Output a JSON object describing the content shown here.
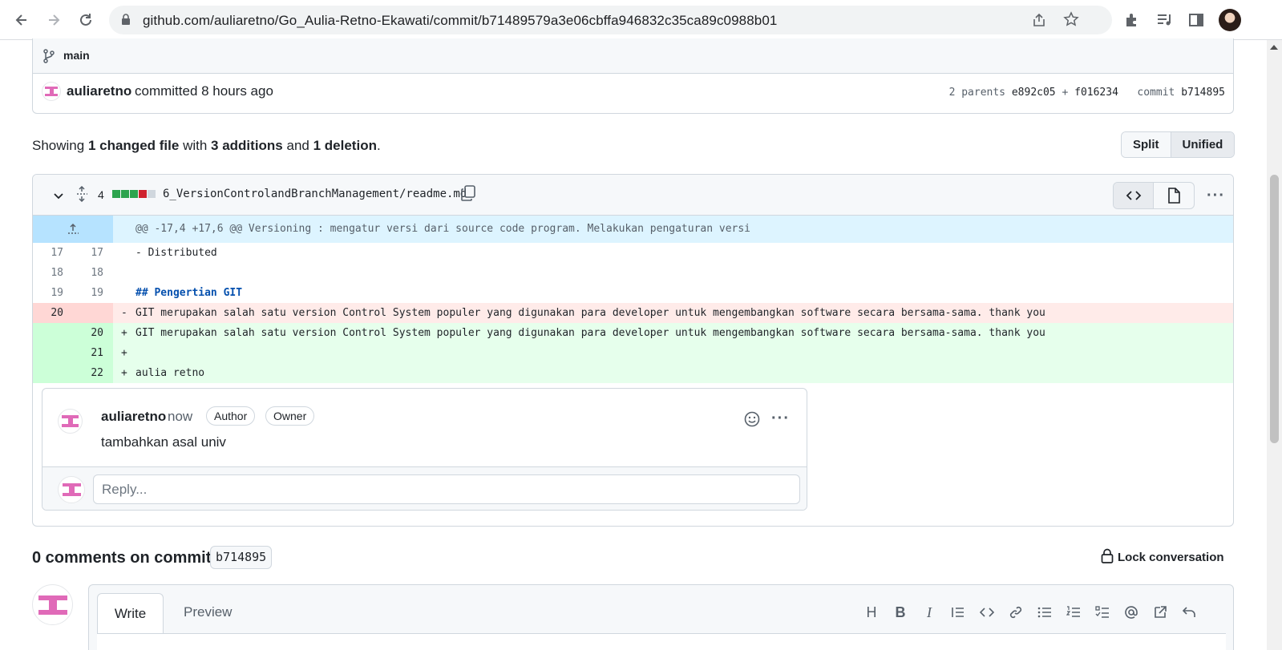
{
  "browser": {
    "url": "github.com/auliaretno/Go_Aulia-Retno-Ekawati/commit/b71489579a3e06cbffa946832c35ca89c0988b01"
  },
  "commit": {
    "branch": "main",
    "author": "auliaretno",
    "committed_text": "committed 8 hours ago",
    "parents_label": "2 parents",
    "parent1": "e892c05",
    "plus": "+",
    "parent2": "f016234",
    "commit_label": "commit",
    "commit_sha": "b714895"
  },
  "summary": {
    "showing": "Showing",
    "changed": "1 changed file",
    "with": "with",
    "additions": "3 additions",
    "and": "and",
    "deletions": "1 deletion",
    "period": ".",
    "split_label": "Split",
    "unified_label": "Unified"
  },
  "file": {
    "change_count": "4",
    "path": "6_VersionControlandBranchManagement/readme.md",
    "diffstat_colors": [
      "#2da44e",
      "#2da44e",
      "#2da44e",
      "#cf222e",
      "#d0d7de"
    ],
    "hunk_header": "@@ -17,4 +17,6 @@ Versioning : mengatur versi dari source code program. Melakukan pengaturan versi",
    "lines": [
      {
        "old": "17",
        "new": "17",
        "sign": "",
        "text": "- Distributed",
        "type": "ctx"
      },
      {
        "old": "18",
        "new": "18",
        "sign": "",
        "text": "",
        "type": "ctx"
      },
      {
        "old": "19",
        "new": "19",
        "sign": "",
        "text": "## Pengertian GIT",
        "type": "ctx"
      },
      {
        "old": "20",
        "new": "",
        "sign": "-",
        "text": "GIT merupakan salah satu version Control System populer yang digunakan para developer untuk mengembangkan software secara bersama-sama. thank you",
        "type": "del"
      },
      {
        "old": "",
        "new": "20",
        "sign": "+",
        "text": "GIT merupakan salah satu version Control System populer yang digunakan para developer untuk mengembangkan software secara bersama-sama. thank you",
        "type": "add"
      },
      {
        "old": "",
        "new": "21",
        "sign": "+",
        "text": "",
        "type": "add"
      },
      {
        "old": "",
        "new": "22",
        "sign": "+",
        "text": "aulia retno",
        "type": "add"
      }
    ]
  },
  "inline_comment": {
    "author": "auliaretno",
    "time": "now",
    "badge_author": "Author",
    "badge_owner": "Owner",
    "body": "tambahkan asal univ",
    "reply_placeholder": "Reply..."
  },
  "comments": {
    "title": "0 comments on commit",
    "sha": "b714895",
    "lock_label": "Lock conversation",
    "tab_write": "Write",
    "tab_preview": "Preview"
  },
  "colors": {
    "accent_add_bg": "#e6ffec",
    "accent_del_bg": "#ffebe9",
    "hunk_bg": "#ddf4ff",
    "identicon": "#e06ab8"
  }
}
